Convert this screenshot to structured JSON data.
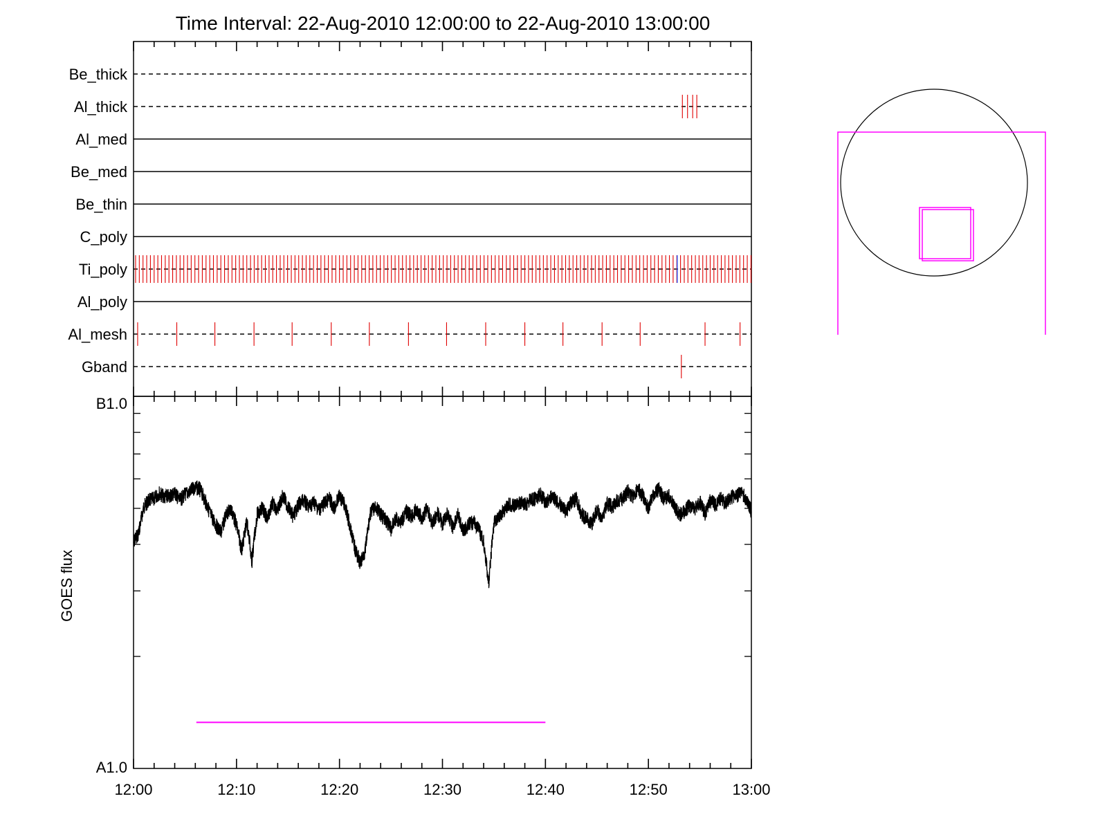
{
  "chart_data": [
    {
      "type": "event_timeline",
      "title": "Time Interval: 22-Aug-2010 12:00:00 to 22-Aug-2010 13:00:00",
      "time_range": [
        "12:00",
        "13:00"
      ],
      "colors": {
        "marker": "#e00000",
        "marker_alt": "#2050ff",
        "axis": "#000000"
      },
      "rows": [
        {
          "label": "Be_thick",
          "line": "dashed",
          "markers": []
        },
        {
          "label": "Al_thick",
          "line": "dashed",
          "markers": [
            53.3,
            53.8,
            54.3,
            54.7
          ]
        },
        {
          "label": "Al_med",
          "line": "solid",
          "markers": []
        },
        {
          "label": "Be_med",
          "line": "solid",
          "markers": []
        },
        {
          "label": "Be_thin",
          "line": "solid",
          "markers": []
        },
        {
          "label": "C_poly",
          "line": "solid",
          "markers": []
        },
        {
          "label": "Ti_poly",
          "line": "dashed",
          "marker_spacing_min": 0.36,
          "alt_marker": 52.8,
          "markers": []
        },
        {
          "label": "Al_poly",
          "line": "solid",
          "markers": []
        },
        {
          "label": "Al_mesh",
          "line": "dashed",
          "markers": [
            0.4,
            4.2,
            7.9,
            11.7,
            15.4,
            19.2,
            22.9,
            26.7,
            30.4,
            34.2,
            38.0,
            41.7,
            45.5,
            49.2,
            55.5,
            58.9
          ]
        },
        {
          "label": "Gband",
          "line": "dashed",
          "markers": [
            53.2
          ]
        }
      ]
    },
    {
      "type": "line",
      "ylabel": "GOES flux",
      "x_ticks": [
        "12:00",
        "12:10",
        "12:20",
        "12:30",
        "12:40",
        "12:50",
        "13:00"
      ],
      "x_range_min": [
        0,
        60
      ],
      "y_ticks": [
        "A1.0",
        "B1.0"
      ],
      "y_range": [
        1e-08,
        1e-07
      ],
      "yscale": "log",
      "line_color": "#000000",
      "interval_line": {
        "start_min": 6.1,
        "end_min": 40.0,
        "level": 1.33e-08,
        "color": "#ff00ff"
      },
      "series": [
        {
          "x": [
            0,
            0.5,
            1,
            1.5,
            2,
            2.5,
            3,
            3.5,
            4,
            4.5,
            5,
            5.5,
            6,
            6.5,
            7,
            7.5,
            8,
            8.5,
            9,
            9.5,
            10,
            10.5,
            11,
            11.5,
            12,
            12.5,
            13,
            13.5,
            14,
            14.5,
            15,
            15.5,
            16,
            16.5,
            17,
            17.5,
            18,
            18.5,
            19,
            19.5,
            20,
            20.5,
            21,
            21.5,
            22,
            22.5,
            23,
            23.5,
            24,
            24.5,
            25,
            25.5,
            26,
            26.5,
            27,
            27.5,
            28,
            28.5,
            29,
            29.5,
            30,
            30.5,
            31,
            31.5,
            32,
            32.5,
            33,
            33.5,
            34,
            34.5,
            35,
            35.5,
            36,
            36.5,
            37,
            37.5,
            38,
            38.5,
            39,
            39.5,
            40,
            40.5,
            41,
            41.5,
            42,
            42.5,
            43,
            43.5,
            44,
            44.5,
            45,
            45.5,
            46,
            46.5,
            47,
            47.5,
            48,
            48.5,
            49,
            49.5,
            50,
            50.5,
            51,
            51.5,
            52,
            52.5,
            53,
            53.5,
            54,
            54.5,
            55,
            55.5,
            56,
            56.5,
            57,
            57.5,
            58,
            58.5,
            59,
            59.5,
            60
          ],
          "y": [
            4.05e-08,
            4.3e-08,
            5.05e-08,
            5.25e-08,
            5.3e-08,
            5.5e-08,
            5.35e-08,
            5.4e-08,
            5.5e-08,
            5.25e-08,
            5.45e-08,
            5.55e-08,
            5.7e-08,
            5.6e-08,
            5.2e-08,
            4.8e-08,
            4.5e-08,
            4.3e-08,
            4.85e-08,
            4.95e-08,
            4.5e-08,
            3.85e-08,
            4.6e-08,
            3.6e-08,
            4.8e-08,
            5e-08,
            4.7e-08,
            5.15e-08,
            4.95e-08,
            5.4e-08,
            5.05e-08,
            4.75e-08,
            5.1e-08,
            5.25e-08,
            5.05e-08,
            5.2e-08,
            4.95e-08,
            5.15e-08,
            5.3e-08,
            5e-08,
            5.4e-08,
            5.1e-08,
            4.5e-08,
            3.9e-08,
            3.55e-08,
            3.85e-08,
            4.85e-08,
            5.05e-08,
            4.8e-08,
            4.65e-08,
            4.4e-08,
            4.7e-08,
            4.6e-08,
            4.9e-08,
            4.75e-08,
            4.95e-08,
            4.7e-08,
            5e-08,
            4.55e-08,
            4.85e-08,
            4.55e-08,
            4.85e-08,
            4.45e-08,
            4.8e-08,
            4.35e-08,
            4.5e-08,
            4.6e-08,
            4.4e-08,
            4.05e-08,
            3.1e-08,
            4.55e-08,
            4.75e-08,
            4.95e-08,
            5.15e-08,
            5.05e-08,
            5.2e-08,
            5.1e-08,
            5.25e-08,
            5.3e-08,
            5.45e-08,
            5.2e-08,
            5.35e-08,
            5.25e-08,
            5.1e-08,
            4.9e-08,
            5.2e-08,
            5.3e-08,
            4.8e-08,
            4.7e-08,
            4.55e-08,
            4.95e-08,
            4.65e-08,
            5.15e-08,
            5.05e-08,
            5.25e-08,
            5.3e-08,
            5.55e-08,
            5.4e-08,
            5.65e-08,
            5.35e-08,
            5e-08,
            5.45e-08,
            5.6e-08,
            5.3e-08,
            5.4e-08,
            5.05e-08,
            4.8e-08,
            4.9e-08,
            5.1e-08,
            4.95e-08,
            5.2e-08,
            4.85e-08,
            5.25e-08,
            5.1e-08,
            5.3e-08,
            5.15e-08,
            5.35e-08,
            5.4e-08,
            5.5e-08,
            5.3e-08,
            4.9e-08
          ]
        }
      ]
    },
    {
      "type": "diagram",
      "shapes": [
        "circle",
        "frame",
        "box"
      ],
      "colors": {
        "circle": "#000000",
        "frame": "#ff00ff",
        "box": "#ff00ff"
      }
    }
  ]
}
